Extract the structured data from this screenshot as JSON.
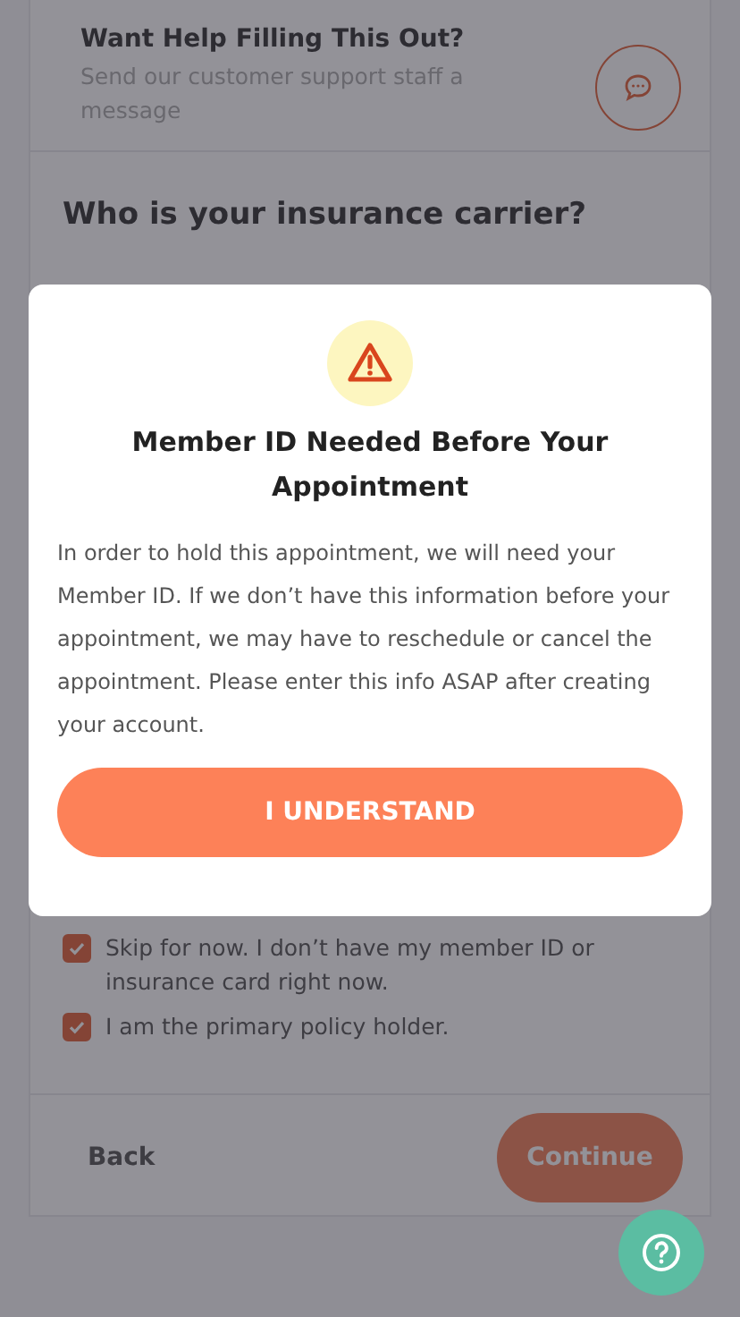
{
  "help": {
    "title": "Want Help Filling This Out?",
    "subtitle": "Send our customer support staff a message"
  },
  "question": "Who is your insurance carrier?",
  "checkboxes": [
    {
      "label": "Skip for now. I don’t have my member ID or insurance card right now.",
      "checked": true
    },
    {
      "label": "I am the primary policy holder.",
      "checked": true
    }
  ],
  "back_button": "Back",
  "continue_button": "Continue",
  "modal": {
    "title": "Member ID Needed Before Your Appointment",
    "body": "In order to hold this appointment, we will need your Member ID. If we don’t have this information before your appointment, we may have to reschedule or cancel the appointment. Please enter this info ASAP after creating your account.",
    "button": "I UNDERSTAND"
  }
}
